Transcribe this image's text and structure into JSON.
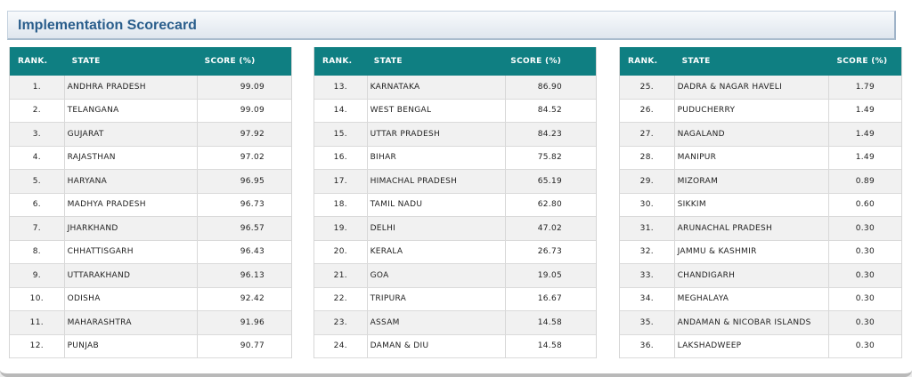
{
  "title": "Implementation Scorecard",
  "headers": {
    "rank": "RANK.",
    "state": "STATE",
    "score": "SCORE (%)"
  },
  "columns": [
    [
      {
        "rank": "1.",
        "state": "ANDHRA PRADESH",
        "score": "99.09"
      },
      {
        "rank": "2.",
        "state": "TELANGANA",
        "score": "99.09"
      },
      {
        "rank": "3.",
        "state": "GUJARAT",
        "score": "97.92"
      },
      {
        "rank": "4.",
        "state": "RAJASTHAN",
        "score": "97.02"
      },
      {
        "rank": "5.",
        "state": "HARYANA",
        "score": "96.95"
      },
      {
        "rank": "6.",
        "state": "MADHYA PRADESH",
        "score": "96.73"
      },
      {
        "rank": "7.",
        "state": "JHARKHAND",
        "score": "96.57"
      },
      {
        "rank": "8.",
        "state": "CHHATTISGARH",
        "score": "96.43"
      },
      {
        "rank": "9.",
        "state": "UTTARAKHAND",
        "score": "96.13"
      },
      {
        "rank": "10.",
        "state": "ODISHA",
        "score": "92.42"
      },
      {
        "rank": "11.",
        "state": "MAHARASHTRA",
        "score": "91.96"
      },
      {
        "rank": "12.",
        "state": "PUNJAB",
        "score": "90.77"
      }
    ],
    [
      {
        "rank": "13.",
        "state": "KARNATAKA",
        "score": "86.90"
      },
      {
        "rank": "14.",
        "state": "WEST BENGAL",
        "score": "84.52"
      },
      {
        "rank": "15.",
        "state": "UTTAR PRADESH",
        "score": "84.23"
      },
      {
        "rank": "16.",
        "state": "BIHAR",
        "score": "75.82"
      },
      {
        "rank": "17.",
        "state": "HIMACHAL PRADESH",
        "score": "65.19"
      },
      {
        "rank": "18.",
        "state": "TAMIL NADU",
        "score": "62.80"
      },
      {
        "rank": "19.",
        "state": "DELHI",
        "score": "47.02"
      },
      {
        "rank": "20.",
        "state": "KERALA",
        "score": "26.73"
      },
      {
        "rank": "21.",
        "state": "GOA",
        "score": "19.05"
      },
      {
        "rank": "22.",
        "state": "TRIPURA",
        "score": "16.67"
      },
      {
        "rank": "23.",
        "state": "ASSAM",
        "score": "14.58"
      },
      {
        "rank": "24.",
        "state": "DAMAN & DIU",
        "score": "14.58"
      }
    ],
    [
      {
        "rank": "25.",
        "state": "DADRA & NAGAR HAVELI",
        "score": "1.79"
      },
      {
        "rank": "26.",
        "state": "PUDUCHERRY",
        "score": "1.49"
      },
      {
        "rank": "27.",
        "state": "NAGALAND",
        "score": "1.49"
      },
      {
        "rank": "28.",
        "state": "MANIPUR",
        "score": "1.49"
      },
      {
        "rank": "29.",
        "state": "MIZORAM",
        "score": "0.89"
      },
      {
        "rank": "30.",
        "state": "SIKKIM",
        "score": "0.60"
      },
      {
        "rank": "31.",
        "state": "ARUNACHAL PRADESH",
        "score": "0.30"
      },
      {
        "rank": "32.",
        "state": "JAMMU & KASHMIR",
        "score": "0.30"
      },
      {
        "rank": "33.",
        "state": "CHANDIGARH",
        "score": "0.30"
      },
      {
        "rank": "34.",
        "state": "MEGHALAYA",
        "score": "0.30"
      },
      {
        "rank": "35.",
        "state": "ANDAMAN & NICOBAR ISLANDS",
        "score": "0.30"
      },
      {
        "rank": "36.",
        "state": "LAKSHADWEEP",
        "score": "0.30"
      }
    ]
  ],
  "colors": {
    "header_teal": "#0f7f82",
    "title_blue": "#2a5e8c",
    "row_alt": "#f1f1f1"
  }
}
